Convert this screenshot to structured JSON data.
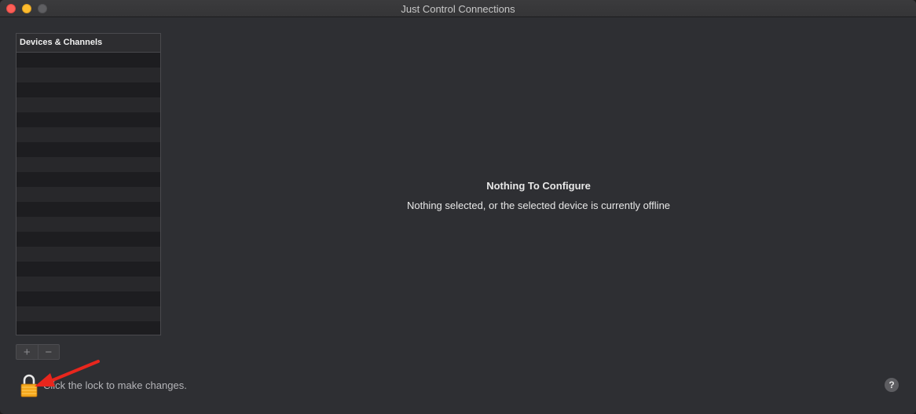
{
  "window": {
    "title": "Just Control Connections"
  },
  "sidebar": {
    "header": "Devices & Channels",
    "row_count": 19
  },
  "toolbar": {
    "add_label": "+",
    "remove_label": "−"
  },
  "main": {
    "title": "Nothing To Configure",
    "subtitle": "Nothing selected, or the selected device is currently offline"
  },
  "footer": {
    "lock_text": "Click the lock to make changes.",
    "help_label": "?",
    "lock_icon": "lock-icon",
    "arrow_color": "#e8261d"
  }
}
